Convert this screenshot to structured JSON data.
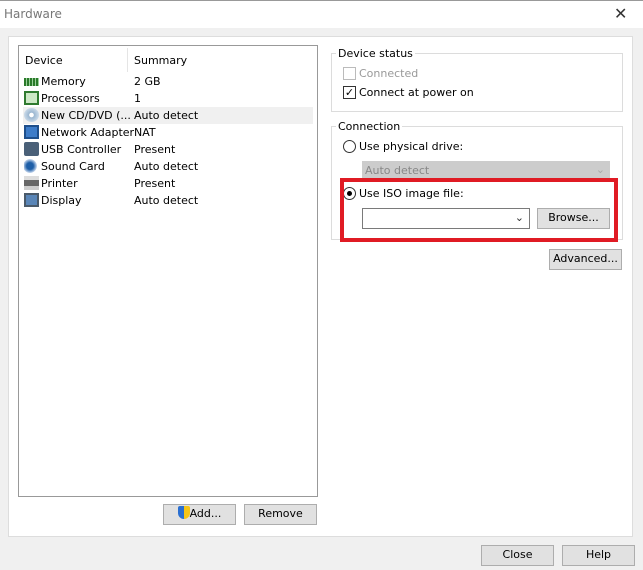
{
  "window": {
    "title": "Hardware",
    "close_icon": "close-icon"
  },
  "device_list": {
    "columns": [
      "Device",
      "Summary"
    ],
    "rows": [
      {
        "device": "Memory",
        "summary": "2 GB",
        "icon": "memory-icon"
      },
      {
        "device": "Processors",
        "summary": "1",
        "icon": "processor-icon"
      },
      {
        "device": "New CD/DVD (...",
        "summary": "Auto detect",
        "icon": "cd-dvd-icon",
        "selected": true
      },
      {
        "device": "Network Adapter",
        "summary": "NAT",
        "icon": "network-icon"
      },
      {
        "device": "USB Controller",
        "summary": "Present",
        "icon": "usb-icon"
      },
      {
        "device": "Sound Card",
        "summary": "Auto detect",
        "icon": "sound-icon"
      },
      {
        "device": "Printer",
        "summary": "Present",
        "icon": "printer-icon"
      },
      {
        "device": "Display",
        "summary": "Auto detect",
        "icon": "display-icon"
      }
    ],
    "add_label": "Add...",
    "remove_label": "Remove"
  },
  "device_status": {
    "legend": "Device status",
    "connected_label": "Connected",
    "connected_checked": false,
    "connected_enabled": false,
    "power_on_label": "Connect at power on",
    "power_on_checked": true
  },
  "connection": {
    "legend": "Connection",
    "physical_label": "Use physical drive:",
    "physical_selected": false,
    "physical_value": "Auto detect",
    "iso_label": "Use ISO image file:",
    "iso_selected": true,
    "iso_value": "",
    "browse_label": "Browse...",
    "advanced_label": "Advanced..."
  },
  "highlight_color": "#e01b24",
  "footer": {
    "close_label": "Close",
    "help_label": "Help"
  }
}
